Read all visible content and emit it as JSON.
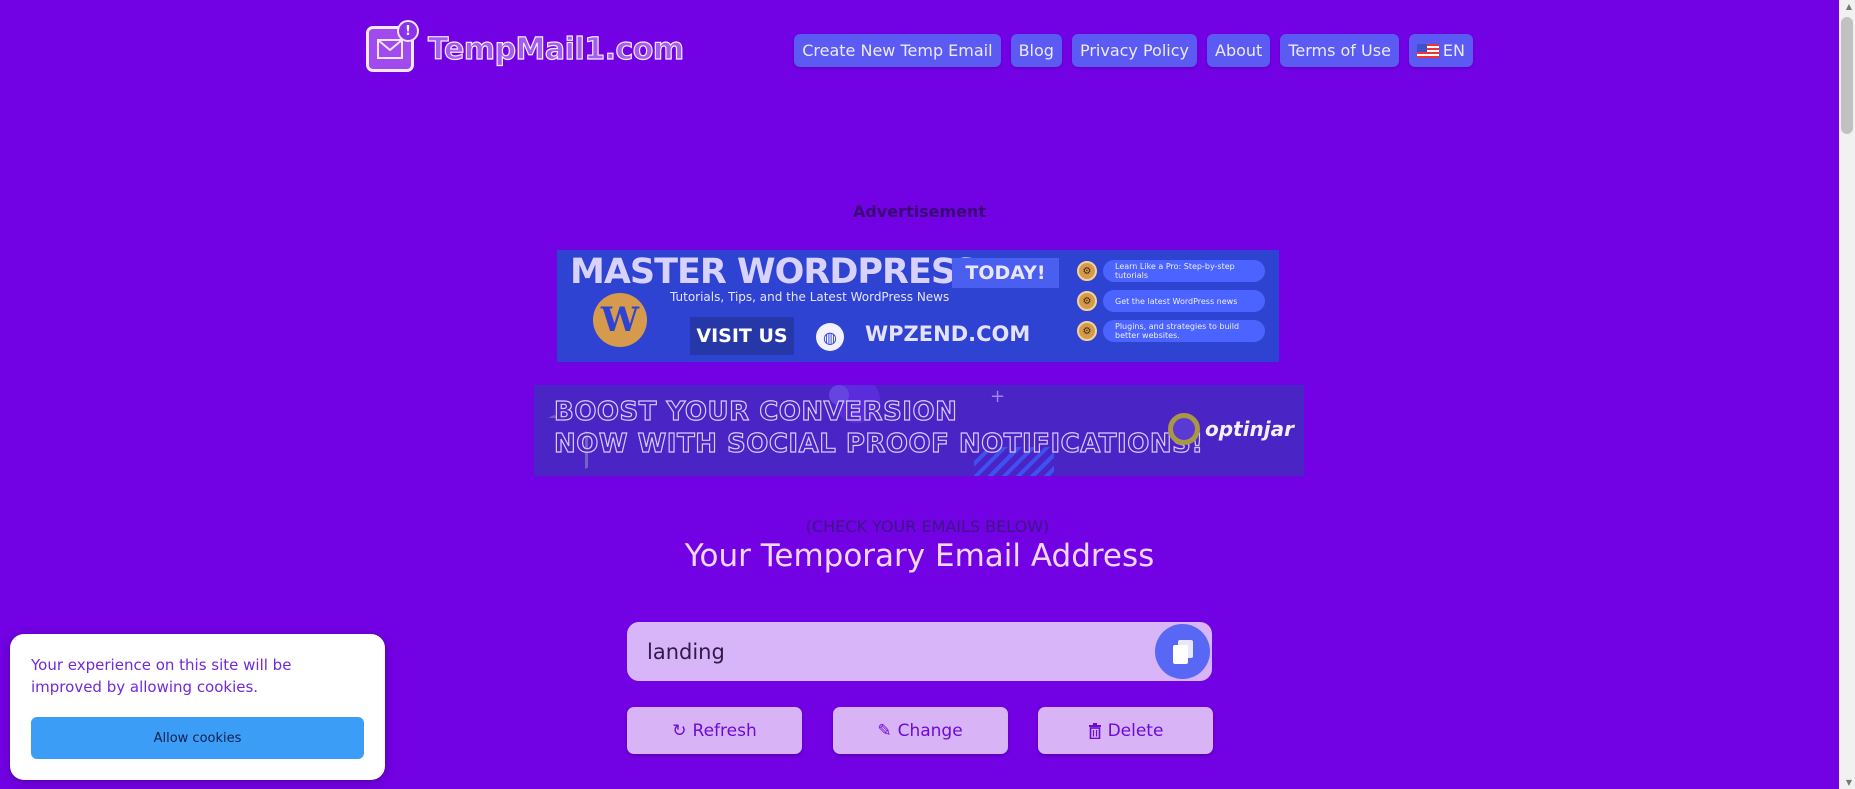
{
  "logo": {
    "text": "TempMail1.com",
    "badge": "!"
  },
  "nav": [
    {
      "label": "Create New Temp Email"
    },
    {
      "label": "Blog"
    },
    {
      "label": "Privacy Policy"
    },
    {
      "label": "About"
    },
    {
      "label": "Terms of Use"
    },
    {
      "label": "EN"
    }
  ],
  "ads": {
    "label": "Advertisement",
    "wordpress": {
      "title": "MASTER WORDPRESS",
      "badge": "TODAY!",
      "subtitle": "Tutorials, Tips, and the Latest WordPress News",
      "cta": "VISIT US",
      "site": "WPZEND.COM",
      "bullets": [
        "Learn Like a Pro: Step-by-step tutorials",
        "Get the latest WordPress news",
        "Plugins, and strategies to build better websites."
      ]
    },
    "optinjar": {
      "line1": "BOOST YOUR CONVERSION",
      "line2": "NOW WITH SOCIAL PROOF NOTIFICATIONS!",
      "brand": "optinjar"
    }
  },
  "main": {
    "check_label": "(CHECK YOUR EMAILS BELOW)",
    "title": "Your Temporary Email Address",
    "email_value": "landing",
    "actions": {
      "refresh": "Refresh",
      "change": "Change",
      "delete": "Delete"
    }
  },
  "cookie": {
    "message": "Your experience on this site will be improved by allowing cookies.",
    "button": "Allow cookies"
  },
  "colors": {
    "background": "#7201e4",
    "nav_button": "#5b5bf4",
    "action_button": "#d8b4f6",
    "copy_button": "#5968f4",
    "cookie_button": "#3c9df7"
  }
}
